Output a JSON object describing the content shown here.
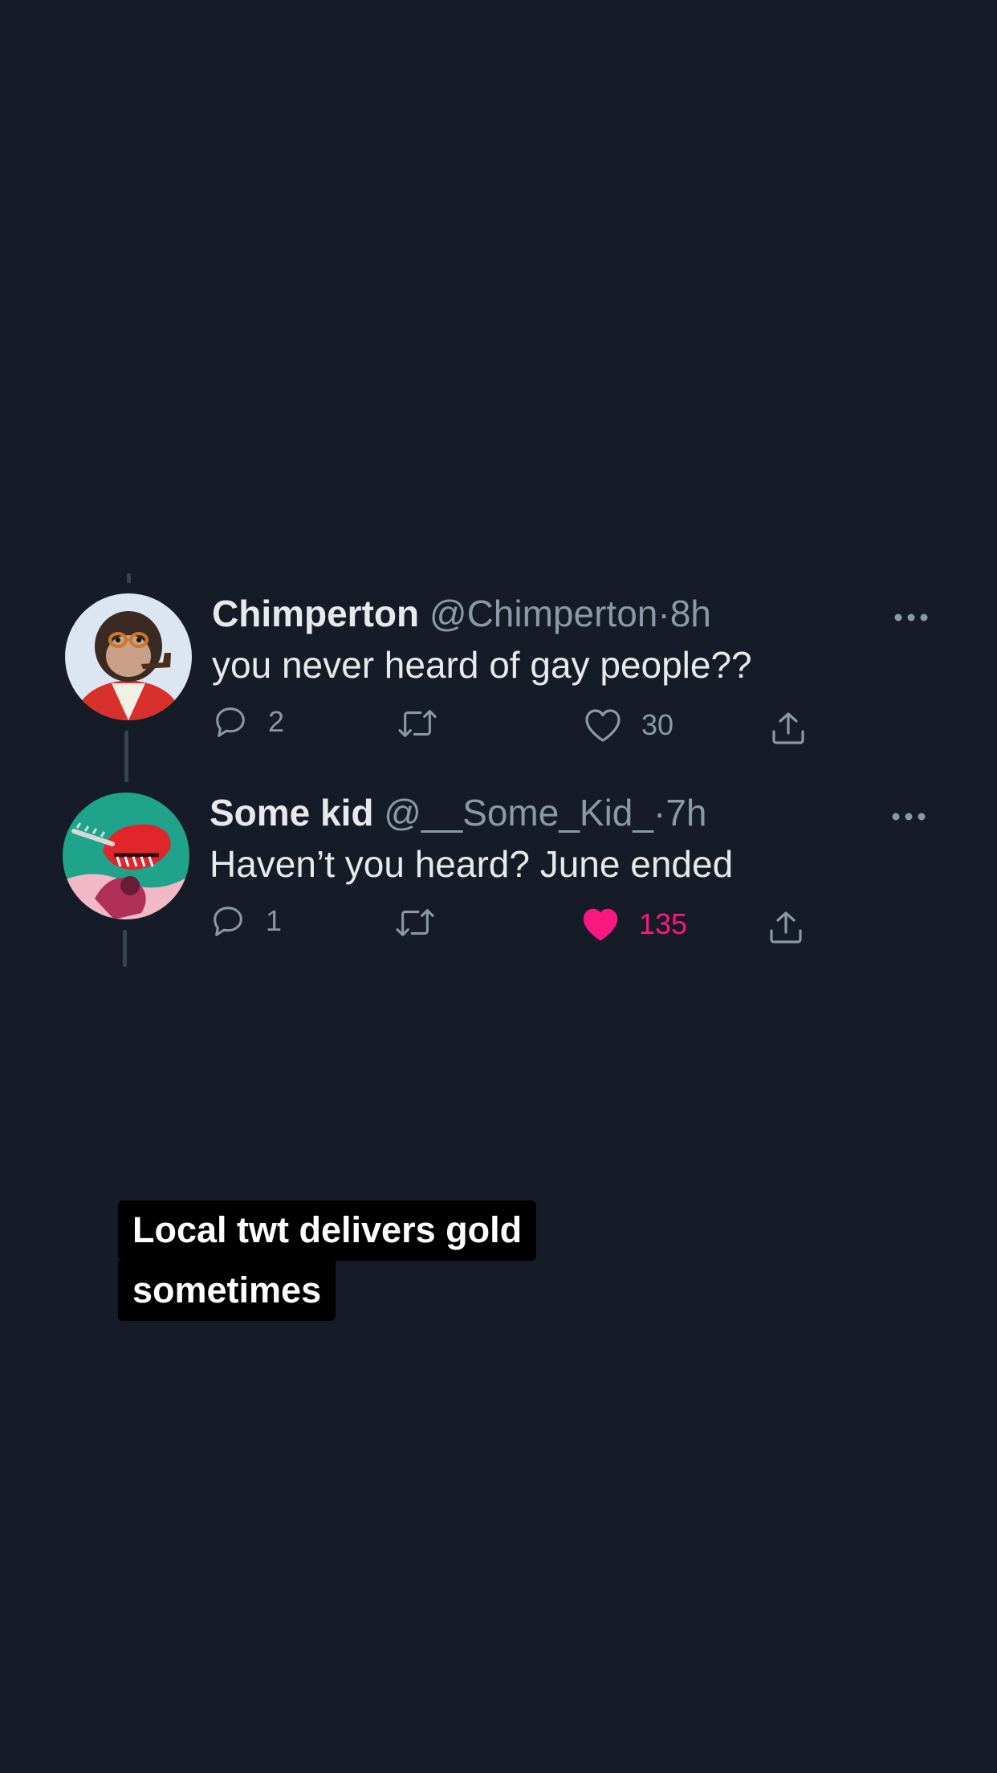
{
  "tweets": [
    {
      "display_name": "Chimperton",
      "handle": "@Chimperton",
      "separator": "·",
      "time": "8h",
      "text": "you never heard of gay people??",
      "replies": "2",
      "likes": "30",
      "liked": false,
      "avatar_icon": "chimp-avatar"
    },
    {
      "display_name": "Some kid",
      "handle": "@__Some_Kid_",
      "separator": "·",
      "time": "7h",
      "text": "Haven’t you heard? June ended",
      "replies": "1",
      "likes": "135",
      "liked": true,
      "avatar_icon": "chainsaw-character-avatar"
    }
  ],
  "caption": {
    "line1": "Local twt delivers gold",
    "line2": "sometimes"
  },
  "icons": {
    "reply": "reply-icon",
    "retweet": "retweet-icon",
    "like": "heart-icon",
    "share": "share-icon",
    "more": "more-icon"
  },
  "colors": {
    "background": "#151c27",
    "text": "#e7e9ea",
    "muted": "#8b98a5",
    "like_active": "#f91880",
    "caption_bg": "#000000"
  }
}
